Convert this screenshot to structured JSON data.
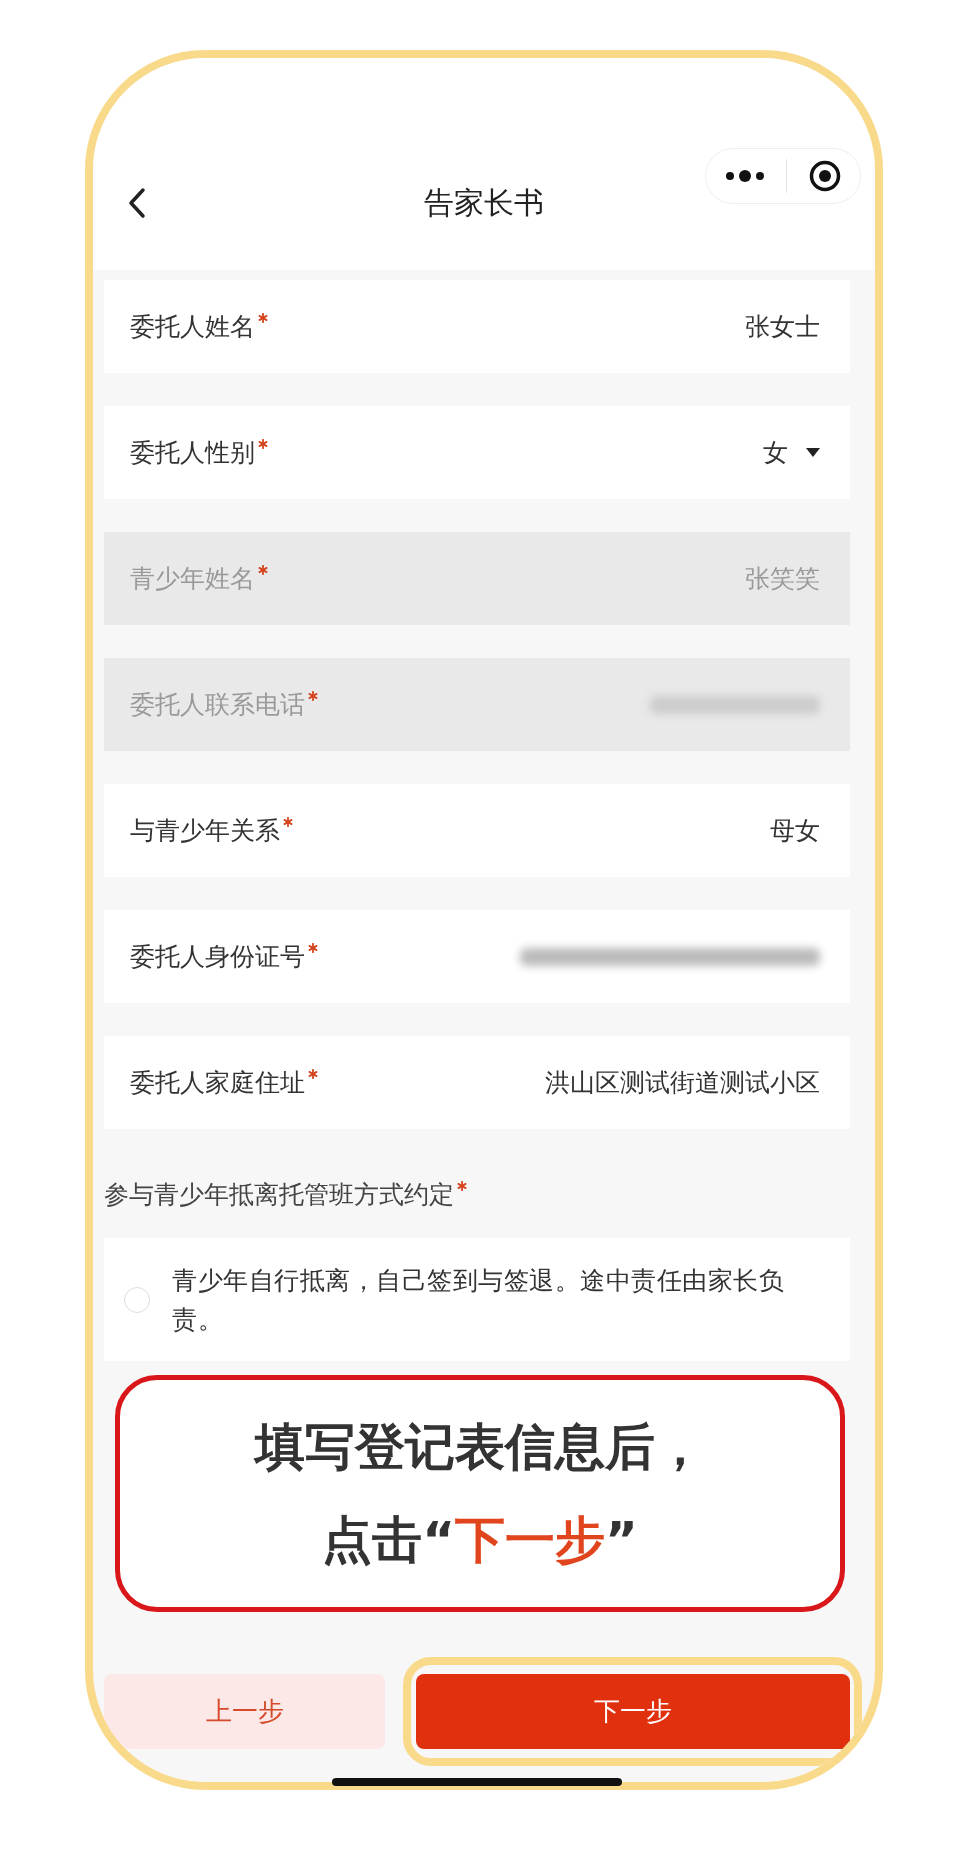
{
  "nav": {
    "title": "告家长书"
  },
  "fields": [
    {
      "label": "委托人姓名",
      "required": true,
      "kind": "text",
      "value": "张女士",
      "disabled": false
    },
    {
      "label": "委托人性别",
      "required": true,
      "kind": "select",
      "value": "女",
      "disabled": false
    },
    {
      "label": "青少年姓名",
      "required": true,
      "kind": "text",
      "value": "张笑笑",
      "disabled": true
    },
    {
      "label": "委托人联系电话",
      "required": true,
      "kind": "masked",
      "disabled": true
    },
    {
      "label": "与青少年关系",
      "required": true,
      "kind": "text",
      "value": "母女",
      "disabled": false
    },
    {
      "label": "委托人身份证号",
      "required": true,
      "kind": "masked",
      "disabled": false
    },
    {
      "label": "委托人家庭住址",
      "required": true,
      "kind": "text",
      "value": "洪山区测试街道测试小区",
      "disabled": false
    }
  ],
  "section": {
    "label": "参与青少年抵离托管班方式约定",
    "required": true
  },
  "options": [
    {
      "text": "青少年自行抵离，自己签到与签退。途中责任由家长负责。",
      "selected": false
    }
  ],
  "callout": {
    "line1": "填写登记表信息后，",
    "prefix": "点击“",
    "highlight": "下一步",
    "suffix": "”"
  },
  "buttons": [
    {
      "label": "上一步",
      "kind": "secondary",
      "highlighted": false
    },
    {
      "label": "下一步",
      "kind": "primary",
      "highlighted": true
    }
  ]
}
